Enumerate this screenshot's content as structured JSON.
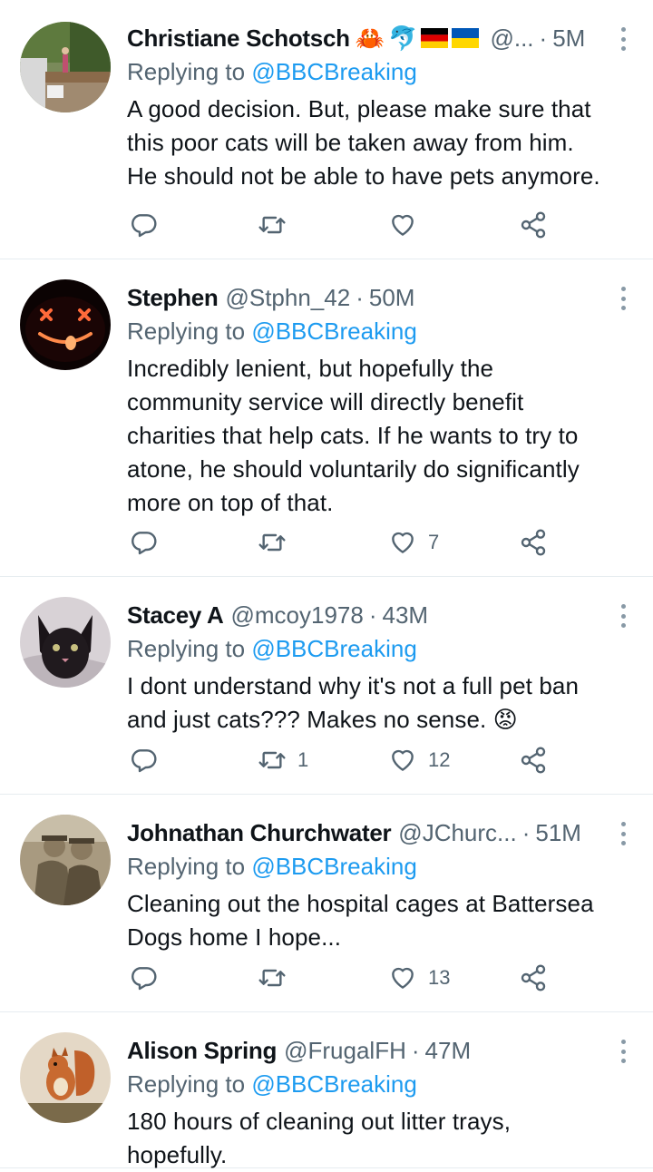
{
  "tweets": [
    {
      "name": "Christiane Schotsch",
      "emoji": [
        "🦀",
        "🐬"
      ],
      "flags": [
        "germany",
        "ukraine"
      ],
      "handle": "@...",
      "time": "5M",
      "replying_prefix": "Replying to",
      "replying_to": "@BBCBreaking",
      "lines": [
        "A good decision. But, please make sure that",
        "this poor cats will be taken away from him.",
        "He should not be able to have pets anymore."
      ],
      "retweets": "",
      "likes": ""
    },
    {
      "name": "Stephen",
      "handle": "@Stphn_42",
      "time": "50M",
      "replying_prefix": "Replying to",
      "replying_to": "@BBCBreaking",
      "lines": [
        "Incredibly lenient, but hopefully the",
        "community service will directly benefit",
        "charities that help cats. If he wants to try to",
        "atone, he should voluntarily do significantly",
        "more on top of that."
      ],
      "retweets": "",
      "likes": "7"
    },
    {
      "name": "Stacey A",
      "handle": "@mcoy1978",
      "time": "43M",
      "replying_prefix": "Replying to",
      "replying_to": "@BBCBreaking",
      "lines": [
        "I dont understand why it's not a full pet ban",
        "and just cats??? Makes no sense. 😡"
      ],
      "retweets": "1",
      "likes": "12"
    },
    {
      "name": "Johnathan Churchwater",
      "handle": "@JChurc...",
      "time": "51M",
      "replying_prefix": "Replying to",
      "replying_to": "@BBCBreaking",
      "lines": [
        "Cleaning out the hospital cages at Battersea",
        "Dogs home I hope..."
      ],
      "retweets": "",
      "likes": "13"
    },
    {
      "name": "Alison Spring",
      "handle": "@FrugalFH",
      "time": "47M",
      "replying_prefix": "Replying to",
      "replying_to": "@BBCBreaking",
      "lines": [
        "180 hours of cleaning out litter trays,",
        "hopefully."
      ],
      "retweets": "",
      "likes": ""
    }
  ],
  "separator": "·",
  "colors": {
    "link": "#1d9bf0",
    "muted": "#536471",
    "text": "#0f1419",
    "divider": "#e6ecf0"
  },
  "icons": [
    "reply-icon",
    "retweet-icon",
    "like-icon",
    "share-icon",
    "more-icon"
  ]
}
